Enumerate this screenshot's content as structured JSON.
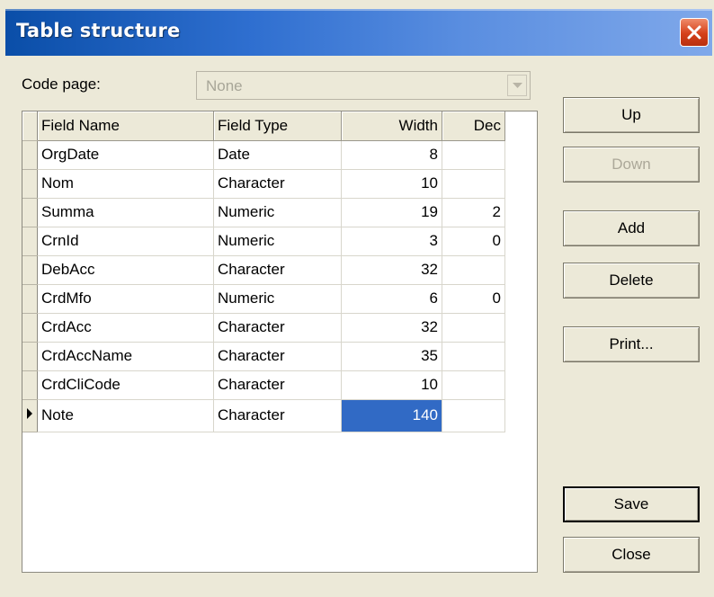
{
  "window": {
    "title": "Table structure"
  },
  "code_page": {
    "label": "Code page:",
    "value": "None"
  },
  "grid": {
    "columns": [
      "Field Name",
      "Field Type",
      "Width",
      "Dec"
    ],
    "rows": [
      {
        "name": "OrgDate",
        "type": "Date",
        "width": "8",
        "dec": ""
      },
      {
        "name": "Nom",
        "type": "Character",
        "width": "10",
        "dec": ""
      },
      {
        "name": "Summa",
        "type": "Numeric",
        "width": "19",
        "dec": "2"
      },
      {
        "name": "CrnId",
        "type": "Numeric",
        "width": "3",
        "dec": "0"
      },
      {
        "name": "DebAcc",
        "type": "Character",
        "width": "32",
        "dec": ""
      },
      {
        "name": "CrdMfo",
        "type": "Numeric",
        "width": "6",
        "dec": "0"
      },
      {
        "name": "CrdAcc",
        "type": "Character",
        "width": "32",
        "dec": ""
      },
      {
        "name": "CrdAccName",
        "type": "Character",
        "width": "35",
        "dec": ""
      },
      {
        "name": "CrdCliCode",
        "type": "Character",
        "width": "10",
        "dec": ""
      },
      {
        "name": "Note",
        "type": "Character",
        "width": "140",
        "dec": ""
      }
    ]
  },
  "buttons": {
    "up": "Up",
    "down": "Down",
    "add": "Add",
    "delete": "Delete",
    "print": "Print...",
    "save": "Save",
    "close": "Close"
  },
  "colors": {
    "titlebar": "#0a4ea8",
    "selection": "#316ac5",
    "close_button": "#d5401a"
  }
}
